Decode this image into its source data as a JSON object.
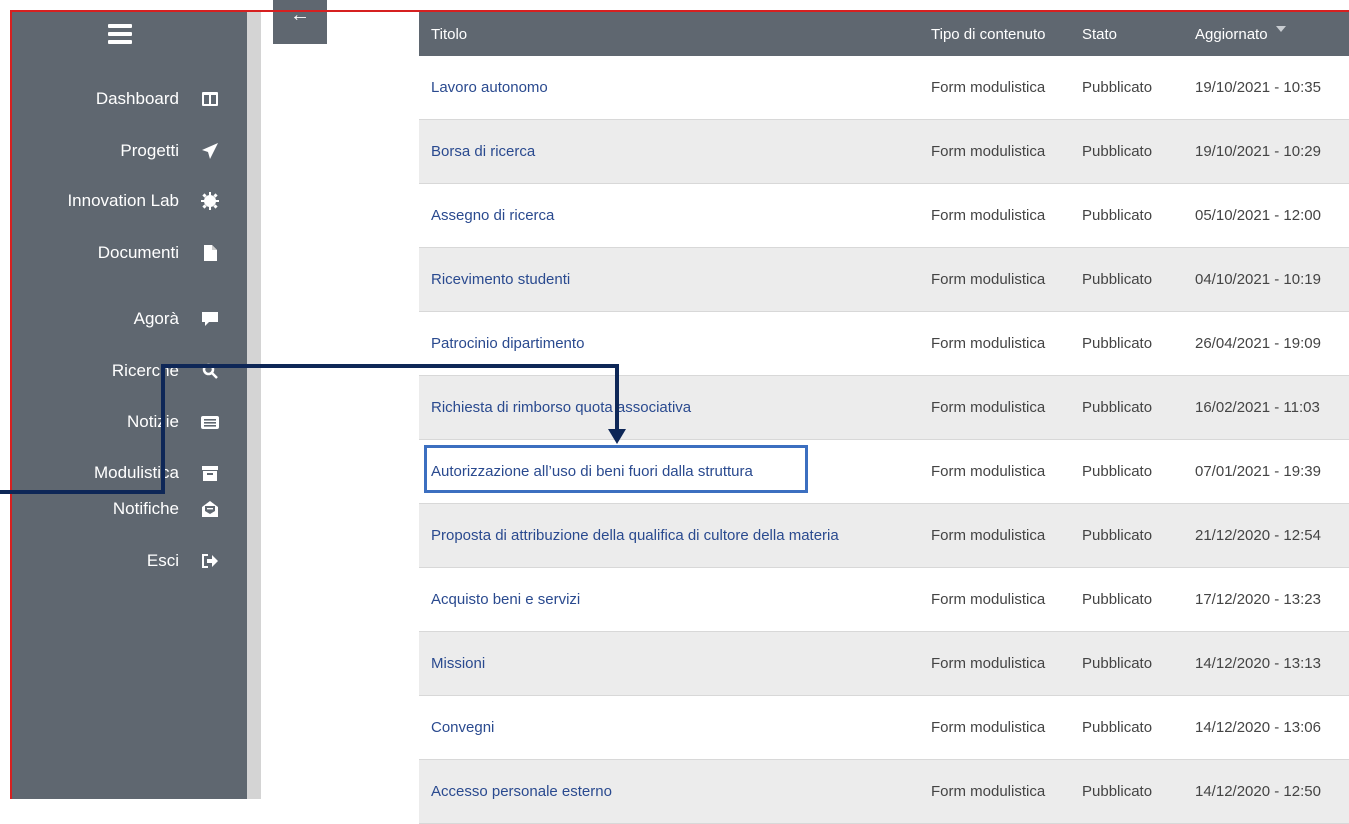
{
  "sidebar": {
    "menu_label": "Menu",
    "items": [
      {
        "label": "Dashboard",
        "icon": "dashboard-icon"
      },
      {
        "label": "Progetti",
        "icon": "paper-plane-icon"
      },
      {
        "label": "Innovation Lab",
        "icon": "gear-icon"
      },
      {
        "label": "Documenti",
        "icon": "file-icon"
      },
      {
        "label": "Agorà",
        "icon": "comment-icon"
      },
      {
        "label": "Ricerche",
        "icon": "search-icon"
      },
      {
        "label": "Notizie",
        "icon": "newspaper-icon"
      },
      {
        "label": "Modulistica",
        "icon": "archive-icon"
      },
      {
        "label": "Notifiche",
        "icon": "envelope-open-icon"
      },
      {
        "label": "Esci",
        "icon": "sign-out-icon"
      }
    ]
  },
  "back_button": {
    "glyph": "←"
  },
  "table": {
    "headers": {
      "title": "Titolo",
      "type": "Tipo di contenuto",
      "status": "Stato",
      "updated": "Aggiornato"
    },
    "rows": [
      {
        "title": "Lavoro autonomo",
        "type": "Form modulistica",
        "status": "Pubblicato",
        "updated": "19/10/2021 - 10:35"
      },
      {
        "title": "Borsa di ricerca",
        "type": "Form modulistica",
        "status": "Pubblicato",
        "updated": "19/10/2021 - 10:29"
      },
      {
        "title": "Assegno di ricerca",
        "type": "Form modulistica",
        "status": "Pubblicato",
        "updated": "05/10/2021 - 12:00"
      },
      {
        "title": "Ricevimento studenti",
        "type": "Form modulistica",
        "status": "Pubblicato",
        "updated": "04/10/2021 - 10:19"
      },
      {
        "title": "Patrocinio dipartimento",
        "type": "Form modulistica",
        "status": "Pubblicato",
        "updated": "26/04/2021 - 19:09"
      },
      {
        "title": "Richiesta di rimborso quota associativa",
        "type": "Form modulistica",
        "status": "Pubblicato",
        "updated": "16/02/2021 - 11:03"
      },
      {
        "title": "Autorizzazione all’uso di beni fuori dalla struttura",
        "type": "Form modulistica",
        "status": "Pubblicato",
        "updated": "07/01/2021 - 19:39"
      },
      {
        "title": "Proposta di attribuzione della qualifica di cultore della materia",
        "type": "Form modulistica",
        "status": "Pubblicato",
        "updated": "21/12/2020 - 12:54"
      },
      {
        "title": "Acquisto beni e servizi",
        "type": "Form modulistica",
        "status": "Pubblicato",
        "updated": "17/12/2020 - 13:23"
      },
      {
        "title": "Missioni",
        "type": "Form modulistica",
        "status": "Pubblicato",
        "updated": "14/12/2020 - 13:13"
      },
      {
        "title": "Convegni",
        "type": "Form modulistica",
        "status": "Pubblicato",
        "updated": "14/12/2020 - 13:06"
      },
      {
        "title": "Accesso personale esterno",
        "type": "Form modulistica",
        "status": "Pubblicato",
        "updated": "14/12/2020 - 12:50"
      }
    ]
  },
  "colors": {
    "sidebar_bg": "#5f6770",
    "link": "#2a4a8f",
    "highlight": "#3c6fc0",
    "annotation_arrow": "#0e2757",
    "frame": "#d62020"
  }
}
